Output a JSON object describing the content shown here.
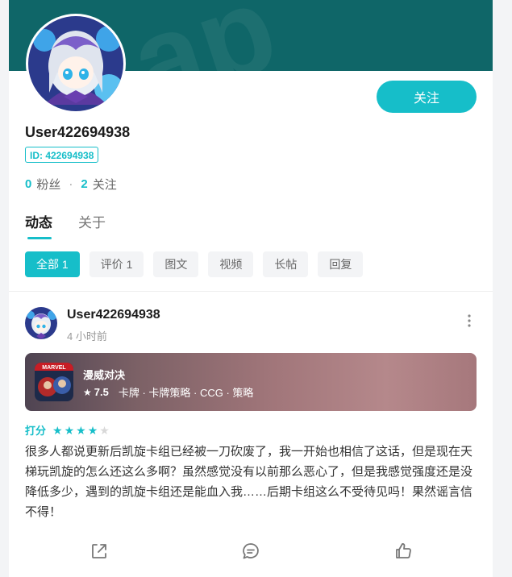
{
  "profile": {
    "username": "User422694938",
    "id_label": "ID: 422694938",
    "followers_count": "0",
    "followers_label": "粉丝",
    "following_count": "2",
    "following_label": "关注",
    "follow_button": "关注"
  },
  "tabs": [
    {
      "label": "动态",
      "active": true
    },
    {
      "label": "关于",
      "active": false
    }
  ],
  "filters": [
    {
      "label": "全部 1",
      "active": true
    },
    {
      "label": "评价 1",
      "active": false
    },
    {
      "label": "图文",
      "active": false
    },
    {
      "label": "视频",
      "active": false
    },
    {
      "label": "长帖",
      "active": false
    },
    {
      "label": "回复",
      "active": false
    }
  ],
  "post": {
    "username": "User422694938",
    "time": "4 小时前",
    "game": {
      "title": "漫威对决",
      "score": "7.5",
      "tags": "卡牌 · 卡牌策略 · CCG · 策略"
    },
    "rating_label": "打分",
    "rating": 4,
    "rating_max": 5,
    "body": "很多人都说更新后凯旋卡组已经被一刀砍废了，我一开始也相信了这话，但是现在天梯玩凯旋的怎么还这么多啊？虽然感觉没有以前那么恶心了，但是我感觉强度还是没降低多少，遇到的凯旋卡组还是能血入我……后期卡组这么不受待见吗！果然谣言信不得！"
  },
  "colors": {
    "accent": "#16bec9",
    "banner": "#0f6668"
  }
}
